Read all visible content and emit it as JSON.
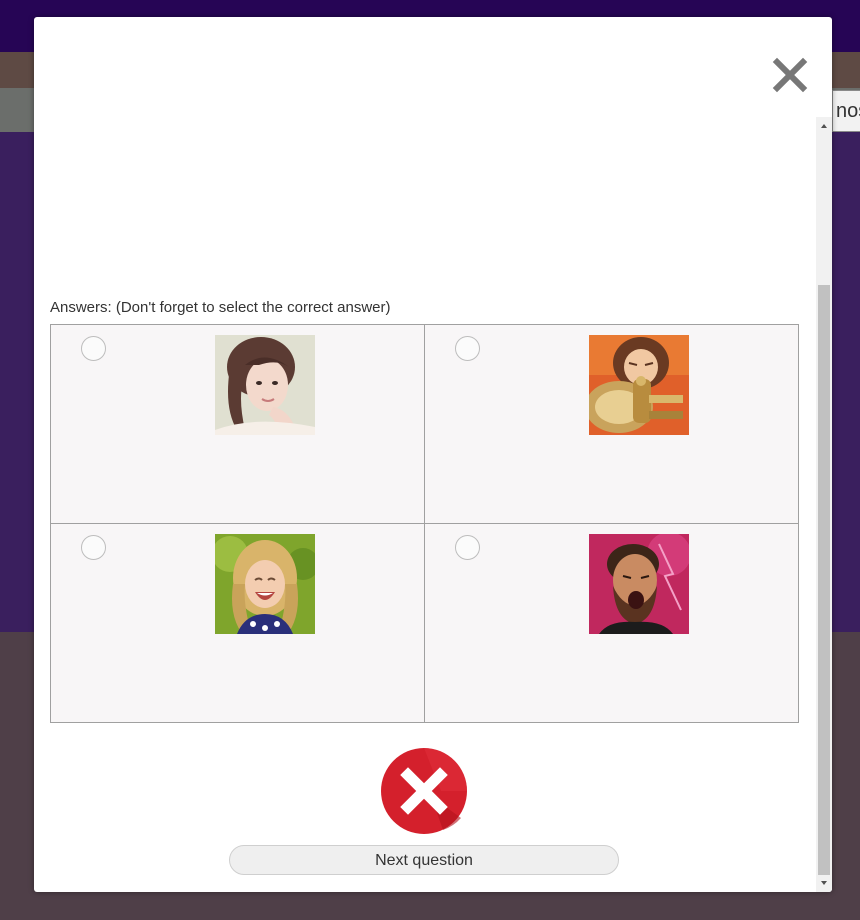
{
  "background": {
    "edge_button_partial_label": "nos"
  },
  "modal": {
    "close_icon": "close-icon",
    "answers_label": "Answers: (Don't forget to select the correct answer)",
    "answers": [
      {
        "image": "young-woman-portrait-photo",
        "selected": false
      },
      {
        "image": "child-playing-tuba-photo",
        "selected": false
      },
      {
        "image": "laughing-girl-photo",
        "selected": false
      },
      {
        "image": "bearded-man-shouting-photo",
        "selected": false
      }
    ],
    "result_icon": "wrong-answer-x-icon",
    "next_button_label": "Next question"
  },
  "colors": {
    "topbar": "#260555",
    "result_red": "#d4202c",
    "modal_bg": "#ffffff"
  }
}
